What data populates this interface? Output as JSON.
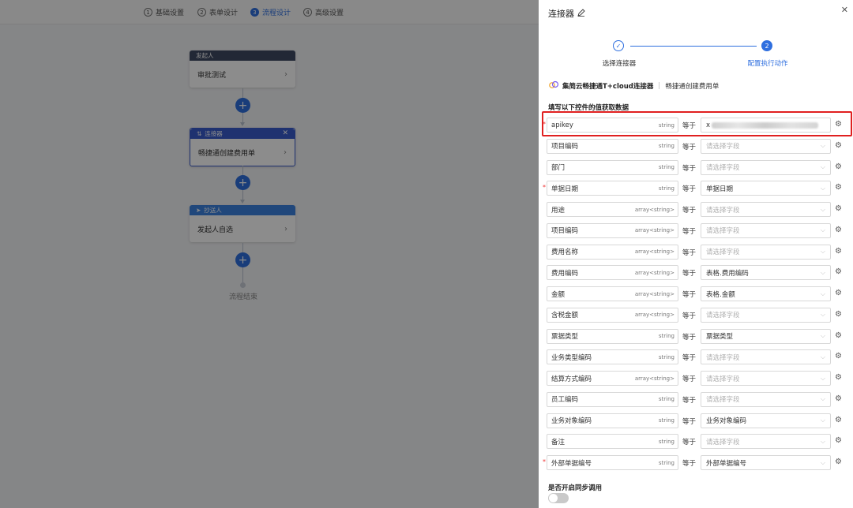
{
  "topbar": {
    "steps": [
      {
        "num": "1",
        "label": "基础设置"
      },
      {
        "num": "2",
        "label": "表单设计"
      },
      {
        "num": "3",
        "label": "流程设计"
      },
      {
        "num": "4",
        "label": "高级设置"
      }
    ],
    "active_step": "流程设计"
  },
  "flow": {
    "nodes": [
      {
        "header": "发起人",
        "body": "审批测试",
        "header_color": "#3f4a63"
      },
      {
        "header": "连接器",
        "body": "畅捷通创建费用单",
        "header_color": "#3a5ccc"
      },
      {
        "header": "抄送人",
        "body": "发起人自选",
        "header_color": "#3b82e0"
      }
    ],
    "end_label": "流程结束"
  },
  "drawer": {
    "title": "连接器",
    "stepper": {
      "step1": "选择连接器",
      "step2": "配置执行动作",
      "step2_num": "2"
    },
    "connector_name": "集简云畅捷通T+cloud连接器",
    "action_name": "畅捷通创建费用单",
    "section_title": "填写以下控件的值获取数据",
    "equals_label": "等于",
    "placeholder": "请选择字段",
    "fields": [
      {
        "name": "apikey",
        "type": "string",
        "required": true,
        "value": "x",
        "blurred": true
      },
      {
        "name": "项目编码",
        "type": "string",
        "required": false,
        "value": ""
      },
      {
        "name": "部门",
        "type": "string",
        "required": false,
        "value": ""
      },
      {
        "name": "单据日期",
        "type": "string",
        "required": true,
        "value": "单据日期"
      },
      {
        "name": "用途",
        "type": "array<string>",
        "required": false,
        "value": ""
      },
      {
        "name": "项目编码",
        "type": "array<string>",
        "required": false,
        "value": ""
      },
      {
        "name": "费用名称",
        "type": "array<string>",
        "required": false,
        "value": ""
      },
      {
        "name": "费用编码",
        "type": "array<string>",
        "required": false,
        "value": "表格.费用编码"
      },
      {
        "name": "金额",
        "type": "array<string>",
        "required": false,
        "value": "表格.金额"
      },
      {
        "name": "含税金额",
        "type": "array<string>",
        "required": false,
        "value": ""
      },
      {
        "name": "票据类型",
        "type": "string",
        "required": false,
        "value": "票据类型"
      },
      {
        "name": "业务类型编码",
        "type": "string",
        "required": false,
        "value": ""
      },
      {
        "name": "结算方式编码",
        "type": "array<string>",
        "required": false,
        "value": ""
      },
      {
        "name": "员工编码",
        "type": "string",
        "required": false,
        "value": ""
      },
      {
        "name": "业务对象编码",
        "type": "string",
        "required": false,
        "value": "业务对象编码"
      },
      {
        "name": "备注",
        "type": "string",
        "required": false,
        "value": ""
      },
      {
        "name": "外部单据编号",
        "type": "string",
        "required": true,
        "value": "外部单据编号"
      }
    ],
    "sync_label": "是否开启同步调用",
    "sync_enabled": false
  },
  "colors": {
    "accent": "#2f6fdf",
    "required": "#e33333",
    "highlight": "#e02020"
  }
}
